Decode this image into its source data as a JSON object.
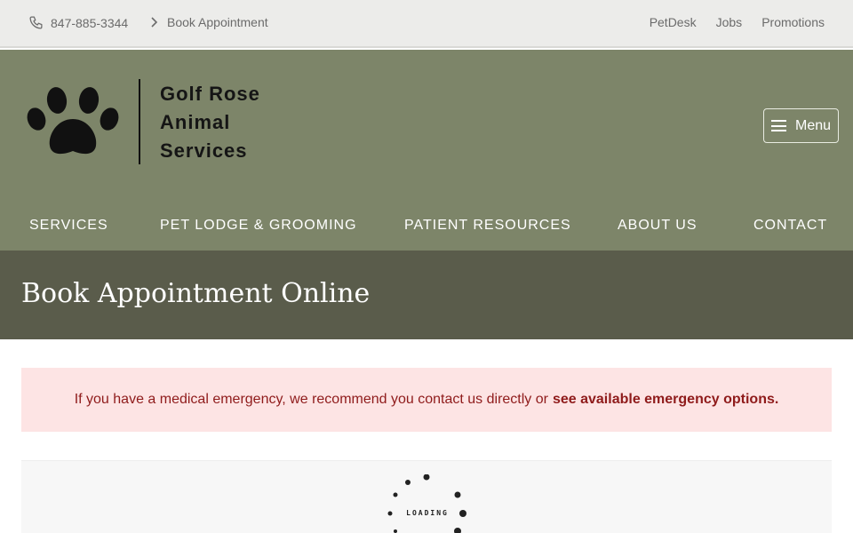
{
  "topbar": {
    "phone": "847-885-3344",
    "book_appointment": "Book Appointment",
    "links": [
      "PetDesk",
      "Jobs",
      "Promotions"
    ]
  },
  "header": {
    "logo_lines": [
      "Golf Rose",
      "Animal",
      "Services"
    ],
    "menu_label": "Menu",
    "logo_icon": "paw-print-icon"
  },
  "nav": {
    "items": [
      "SERVICES",
      "PET LODGE & GROOMING",
      "PATIENT RESOURCES",
      "ABOUT US",
      "CONTACT"
    ]
  },
  "page": {
    "title": "Book Appointment Online"
  },
  "alert": {
    "text": "If you have a medical emergency, we recommend you contact us directly or",
    "link": "see available emergency options."
  },
  "widget": {
    "loading": "LOADING"
  },
  "colors": {
    "header_bg": "#7d8569",
    "title_bg": "#5a5c4b",
    "topbar_bg": "#ececea",
    "alert_bg": "#fde4e4",
    "alert_text": "#8f1b1b"
  }
}
